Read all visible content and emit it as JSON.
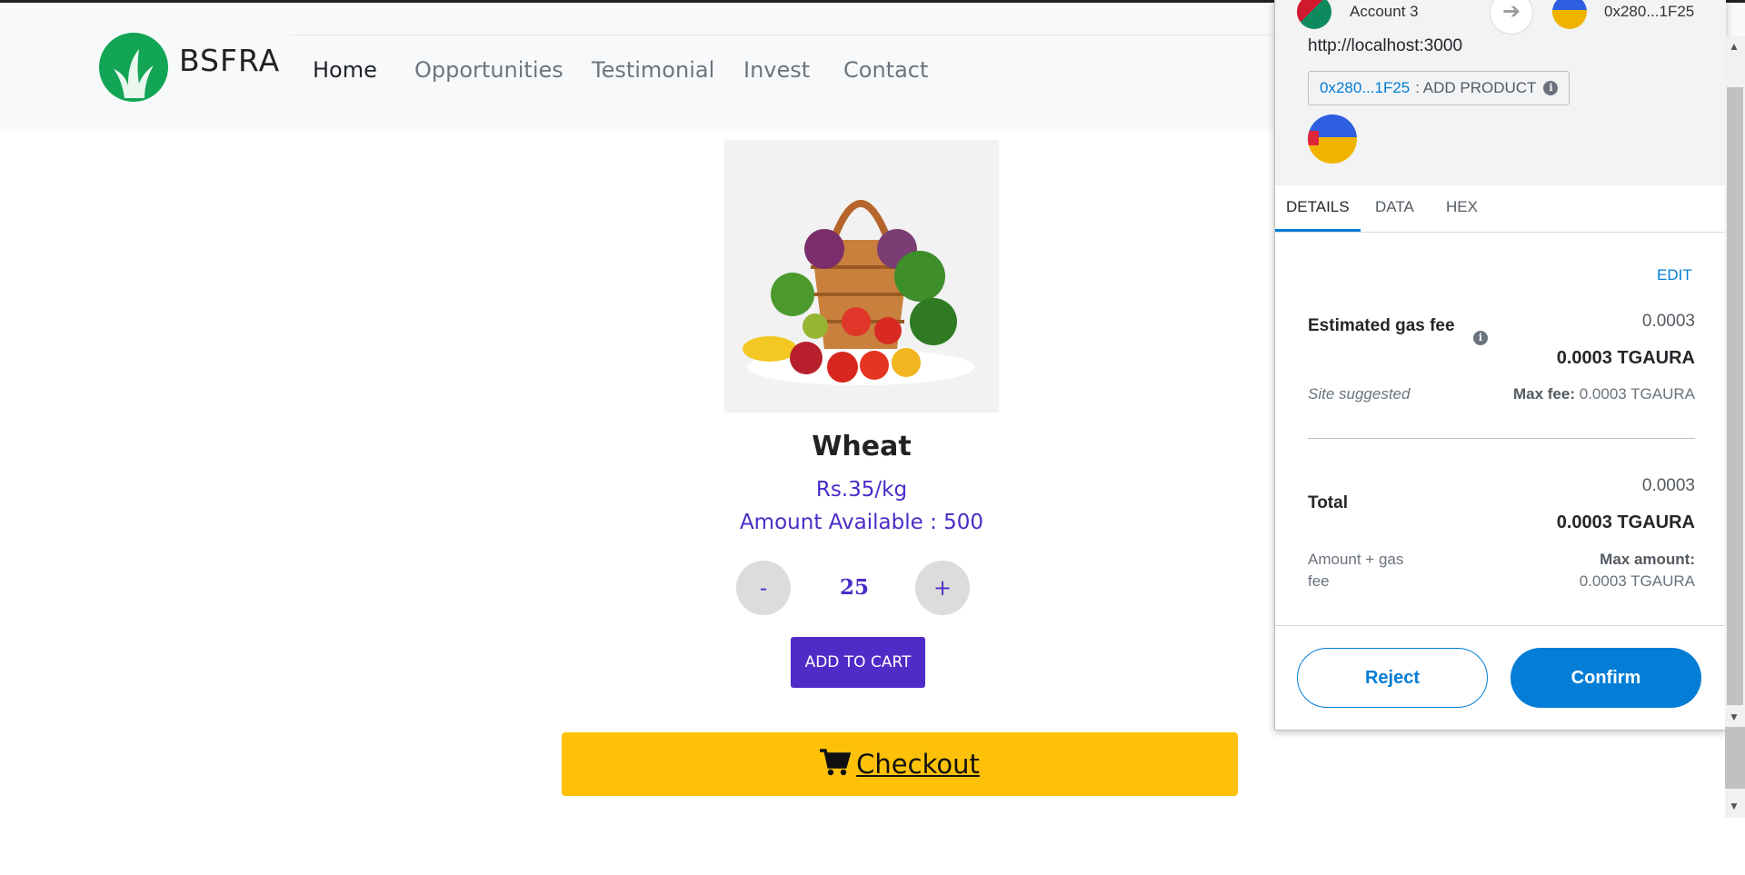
{
  "nav": {
    "brand": "BSFRA",
    "items": [
      "Home",
      "Opportunities",
      "Testimonial",
      "Invest",
      "Contact"
    ]
  },
  "product": {
    "name": "Wheat",
    "price": "Rs.35/kg",
    "amount": "Amount Available : 500",
    "minus_label": "-",
    "plus_label": "+",
    "quantity": "25",
    "add_to_cart": "ADD TO CART"
  },
  "checkout": {
    "label": " Checkout"
  },
  "metamask": {
    "account_name": "Account 3",
    "to_address": "0x280...1F25",
    "origin": "http://localhost:3000",
    "method_address": "0x280...1F25",
    "method_name": ": ADD PRODUCT",
    "tabs": [
      "DETAILS",
      "DATA",
      "HEX"
    ],
    "edit": "EDIT",
    "gas": {
      "label": "Estimated gas fee",
      "value": "0.0003",
      "value_bold": "0.0003 TGAURA",
      "site_suggested": "Site suggested",
      "max_fee_label": "Max fee:",
      "max_fee_value": "0.0003 TGAURA"
    },
    "total": {
      "label": "Total",
      "value": "0.0003",
      "value_bold": "0.0003 TGAURA",
      "sub": "Amount + gas fee",
      "max_amount_label": "Max amount:",
      "max_amount_value": "0.0003 TGAURA"
    },
    "reject": "Reject",
    "confirm": "Confirm"
  },
  "colors": {
    "accent_purple": "#512bc7",
    "checkout_yellow": "#fec107",
    "metamask_blue": "#037dd6",
    "logo_green": "#13a556"
  }
}
